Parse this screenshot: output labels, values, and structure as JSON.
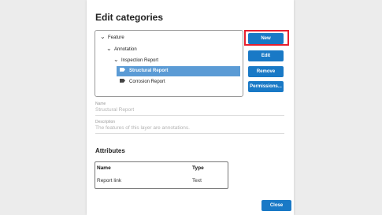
{
  "dialog": {
    "title": "Edit categories",
    "tree": [
      {
        "label": "Feature"
      },
      {
        "label": "Annotation"
      },
      {
        "label": "Inspection Report"
      },
      {
        "label": "Structural Report",
        "selected": true,
        "icon": "tag-icon"
      },
      {
        "label": "Corrosion Report",
        "icon": "tag-icon"
      }
    ],
    "buttons": {
      "new": "New",
      "edit": "Edit",
      "remove": "Remove",
      "permissions": "Permissions..."
    },
    "name_field": {
      "label": "Name",
      "value": "Structural Report"
    },
    "description_field": {
      "label": "Description",
      "value": "The features of this layer are annotations."
    },
    "attributes": {
      "title": "Attributes",
      "columns": [
        "Name",
        "Type"
      ],
      "rows": [
        {
          "name": "Report link",
          "type": "Text"
        }
      ]
    },
    "close_label": "Close",
    "accent_color": "#1979c6",
    "selection_color": "#5b9bd5",
    "highlight_color": "#e8202e"
  }
}
